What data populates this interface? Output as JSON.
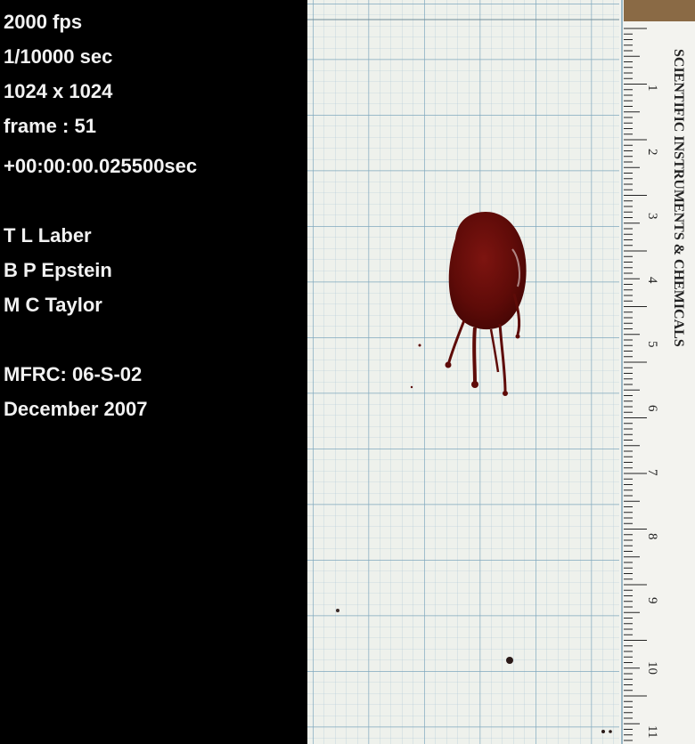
{
  "overlay": {
    "capture_lines": [
      "2000 fps",
      "1/10000 sec",
      "1024 x 1024",
      "frame : 51",
      "+00:00:00.025500sec"
    ],
    "authors": [
      "T L Laber",
      "B P Epstein",
      "M C Taylor"
    ],
    "reference": [
      "MFRC:  06-S-02",
      "December 2007"
    ]
  },
  "ruler": {
    "brand": "SCIENTIFIC INSTRUMENTS & CHEMICALS",
    "numbers": [
      "1",
      "2",
      "3",
      "4",
      "5",
      "6",
      "7",
      "8",
      "9",
      "10",
      "11"
    ]
  },
  "colors": {
    "background": "#000000",
    "paper": "#eef1ec",
    "grid_line": "#8fb4c9",
    "blood": "#6e0f0a",
    "ruler_tan": "#8a6a45"
  }
}
